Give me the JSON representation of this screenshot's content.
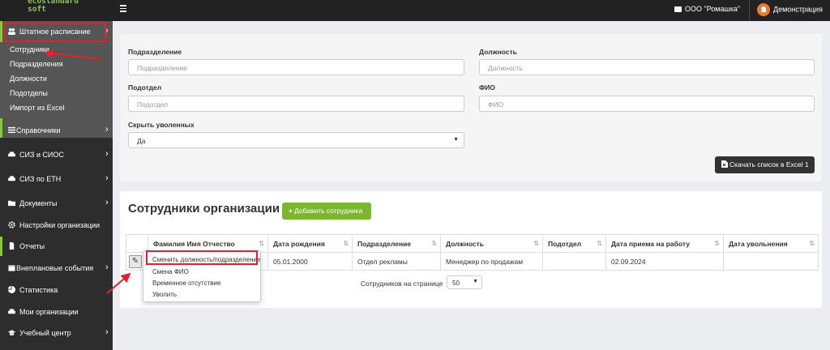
{
  "header": {
    "logo_line1": "ecostandard",
    "logo_line2": "soft",
    "organization": "ООО \"Ромашка\"",
    "user": "Демонстрация"
  },
  "sidebar": {
    "staffing": "Штатное расписание",
    "submenu": [
      "Сотрудники",
      "Подразделения",
      "Должности",
      "Подотделы",
      "Импорт из Excel"
    ],
    "items": [
      {
        "label": "Справочники",
        "icon": "list-icon",
        "chevron": true
      },
      {
        "label": "СИЗ и СИОС",
        "icon": "car-icon",
        "chevron": true
      },
      {
        "label": "СИЗ по ЕТН",
        "icon": "car-icon",
        "chevron": true
      },
      {
        "label": "Документы",
        "icon": "folder-icon",
        "chevron": true
      },
      {
        "label": "Настройки организации",
        "icon": "gear-icon",
        "chevron": false
      },
      {
        "label": "Отчеты",
        "icon": "file-icon",
        "chevron": false
      },
      {
        "label": "Внеплановые события",
        "icon": "calendar-icon",
        "chevron": true
      },
      {
        "label": "Статистика",
        "icon": "pie-chart-icon",
        "chevron": false
      },
      {
        "label": "Мои организации",
        "icon": "car-icon",
        "chevron": false
      },
      {
        "label": "Учебный центр",
        "icon": "graduation-cap-icon",
        "chevron": true
      }
    ]
  },
  "filters": {
    "department_label": "Подразделение",
    "department_placeholder": "Подразделение",
    "position_label": "Должность",
    "position_placeholder": "Должность",
    "subdepartment_label": "Подотдел",
    "subdepartment_placeholder": "Подотдел",
    "fio_label": "ФИО",
    "fio_placeholder": "ФИО",
    "hide_fired_label": "Скрыть уволенных",
    "hide_fired_value": "Да",
    "export_button": "Скачать список в Excel 1"
  },
  "employees": {
    "title": "Сотрудники организации",
    "add_button": "Добавить сотрудника",
    "columns": [
      "Фамилия Имя Отчество",
      "Дата рождения",
      "Подразделение",
      "Должность",
      "Подотдел",
      "Дата приема на работу",
      "Дата увольнения"
    ],
    "rows": [
      [
        "",
        "05.01.2000",
        "Отдел рекламы",
        "Менеджер по продажам",
        "",
        "02.09.2024",
        ""
      ]
    ],
    "per_page_label": "Сотрудников на странице",
    "per_page_value": "50"
  },
  "row_menu": [
    "Сменить должность/подразделение",
    "Смена ФИО",
    "Временное отсутствие",
    "Уволить"
  ],
  "colors": {
    "accent_green": "#7ab72d",
    "highlight_red": "#e3232c",
    "sidebar_bg": "#2d2d2d",
    "topbar_bg": "#222222"
  }
}
